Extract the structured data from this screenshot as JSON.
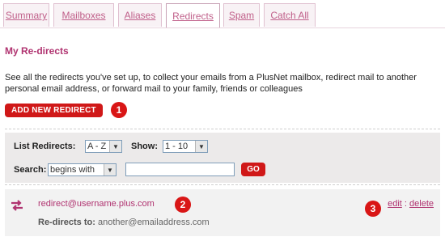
{
  "tabs": [
    "Summary",
    "Mailboxes",
    "Aliases",
    "Redirects",
    "Spam",
    "Catch All"
  ],
  "active_tab": "Redirects",
  "title": "My Re-directs",
  "intro": "See all the redirects you've set up, to collect your emails from a PlusNet mailbox, redirect mail to another personal email address, or forward mail to your family, friends or colleagues",
  "add_button": "ADD NEW REDIRECT",
  "callouts": [
    "1",
    "2",
    "3"
  ],
  "filter": {
    "list_label": "List Redirects:",
    "list_value": "A - Z",
    "show_label": "Show:",
    "show_value": "1 - 10",
    "search_label": "Search:",
    "search_mode": "begins with",
    "search_value": "",
    "go_label": "GO"
  },
  "redirect": {
    "email": "redirect@username.plus.com",
    "redirects_to_label": "Re-directs to:",
    "redirects_to": "another@emailaddress.com",
    "edit_label": "edit",
    "separator": ":",
    "delete_label": "delete"
  },
  "colors": {
    "brand": "#b03370",
    "button": "#d01818",
    "callout": "#d91616"
  },
  "icons": [
    "arrow-down-icon",
    "redirect-arrows-icon"
  ]
}
